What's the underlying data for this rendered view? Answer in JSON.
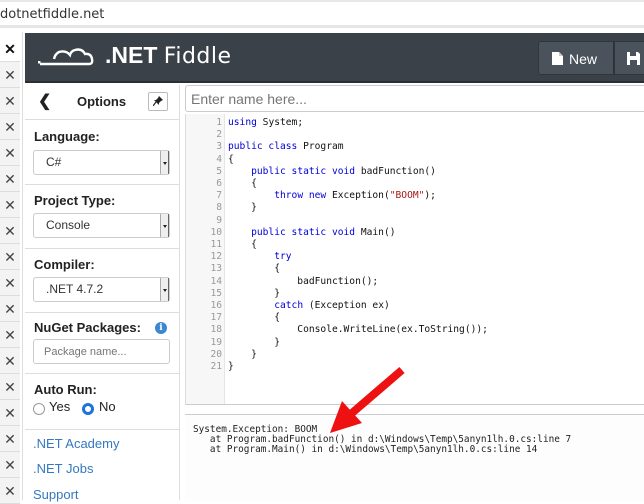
{
  "browser": {
    "url": "dotnetfiddle.net"
  },
  "tabstrip": {
    "close_glyph": "✕",
    "count": 18
  },
  "navbar": {
    "brand_prefix": ".NET",
    "brand_suffix": "Fiddle",
    "logo_icon": "cloud-logo-icon",
    "buttons": [
      {
        "label": "New",
        "icon": "file-icon"
      },
      {
        "label": "",
        "icon": "save-icon"
      }
    ]
  },
  "options": {
    "title": "Options",
    "back_glyph": "❮",
    "pin_glyph": "📌",
    "language": {
      "label": "Language:",
      "value": "C#"
    },
    "project_type": {
      "label": "Project Type:",
      "value": "Console"
    },
    "compiler": {
      "label": "Compiler:",
      "value": ".NET 4.7.2"
    },
    "nuget": {
      "label": "NuGet Packages:",
      "placeholder": "Package name...",
      "info_glyph": "i"
    },
    "auto_run": {
      "label": "Auto Run:",
      "options": [
        "Yes",
        "No"
      ],
      "selected": "No"
    },
    "links": [
      ".NET Academy",
      ".NET Jobs",
      "Support"
    ]
  },
  "fiddle_name": {
    "placeholder": "Enter name here...",
    "value": ""
  },
  "editor": {
    "lines": [
      [
        {
          "t": "using",
          "c": "kw"
        },
        {
          "t": " System;"
        }
      ],
      [],
      [
        {
          "t": "public class",
          "c": "kw"
        },
        {
          "t": " Program"
        }
      ],
      [
        {
          "t": "{"
        }
      ],
      [
        {
          "t": "    "
        },
        {
          "t": "public static void",
          "c": "kw"
        },
        {
          "t": " badFunction()"
        }
      ],
      [
        {
          "t": "    {"
        }
      ],
      [
        {
          "t": "        "
        },
        {
          "t": "throw new",
          "c": "kw"
        },
        {
          "t": " Exception("
        },
        {
          "t": "\"BOOM\"",
          "c": "str"
        },
        {
          "t": ");"
        }
      ],
      [
        {
          "t": "    }"
        }
      ],
      [],
      [
        {
          "t": "    "
        },
        {
          "t": "public static void",
          "c": "kw"
        },
        {
          "t": " Main()"
        }
      ],
      [
        {
          "t": "    {"
        }
      ],
      [
        {
          "t": "        "
        },
        {
          "t": "try",
          "c": "kw"
        }
      ],
      [
        {
          "t": "        {"
        }
      ],
      [
        {
          "t": "            badFunction();"
        }
      ],
      [
        {
          "t": "        }"
        }
      ],
      [
        {
          "t": "        "
        },
        {
          "t": "catch",
          "c": "kw"
        },
        {
          "t": " (Exception ex)"
        }
      ],
      [
        {
          "t": "        {"
        }
      ],
      [
        {
          "t": "            Console.WriteLine(ex.ToString());"
        }
      ],
      [
        {
          "t": "        }"
        }
      ],
      [
        {
          "t": "    }"
        }
      ],
      [
        {
          "t": "}"
        }
      ]
    ]
  },
  "output": {
    "lines": [
      "System.Exception: BOOM",
      "   at Program.badFunction() in d:\\Windows\\Temp\\5anyn1lh.0.cs:line 7",
      "   at Program.Main() in d:\\Windows\\Temp\\5anyn1lh.0.cs:line 14"
    ]
  },
  "annotation": {
    "type": "arrow",
    "color": "#ee1111",
    "points_to": "output exception message"
  }
}
